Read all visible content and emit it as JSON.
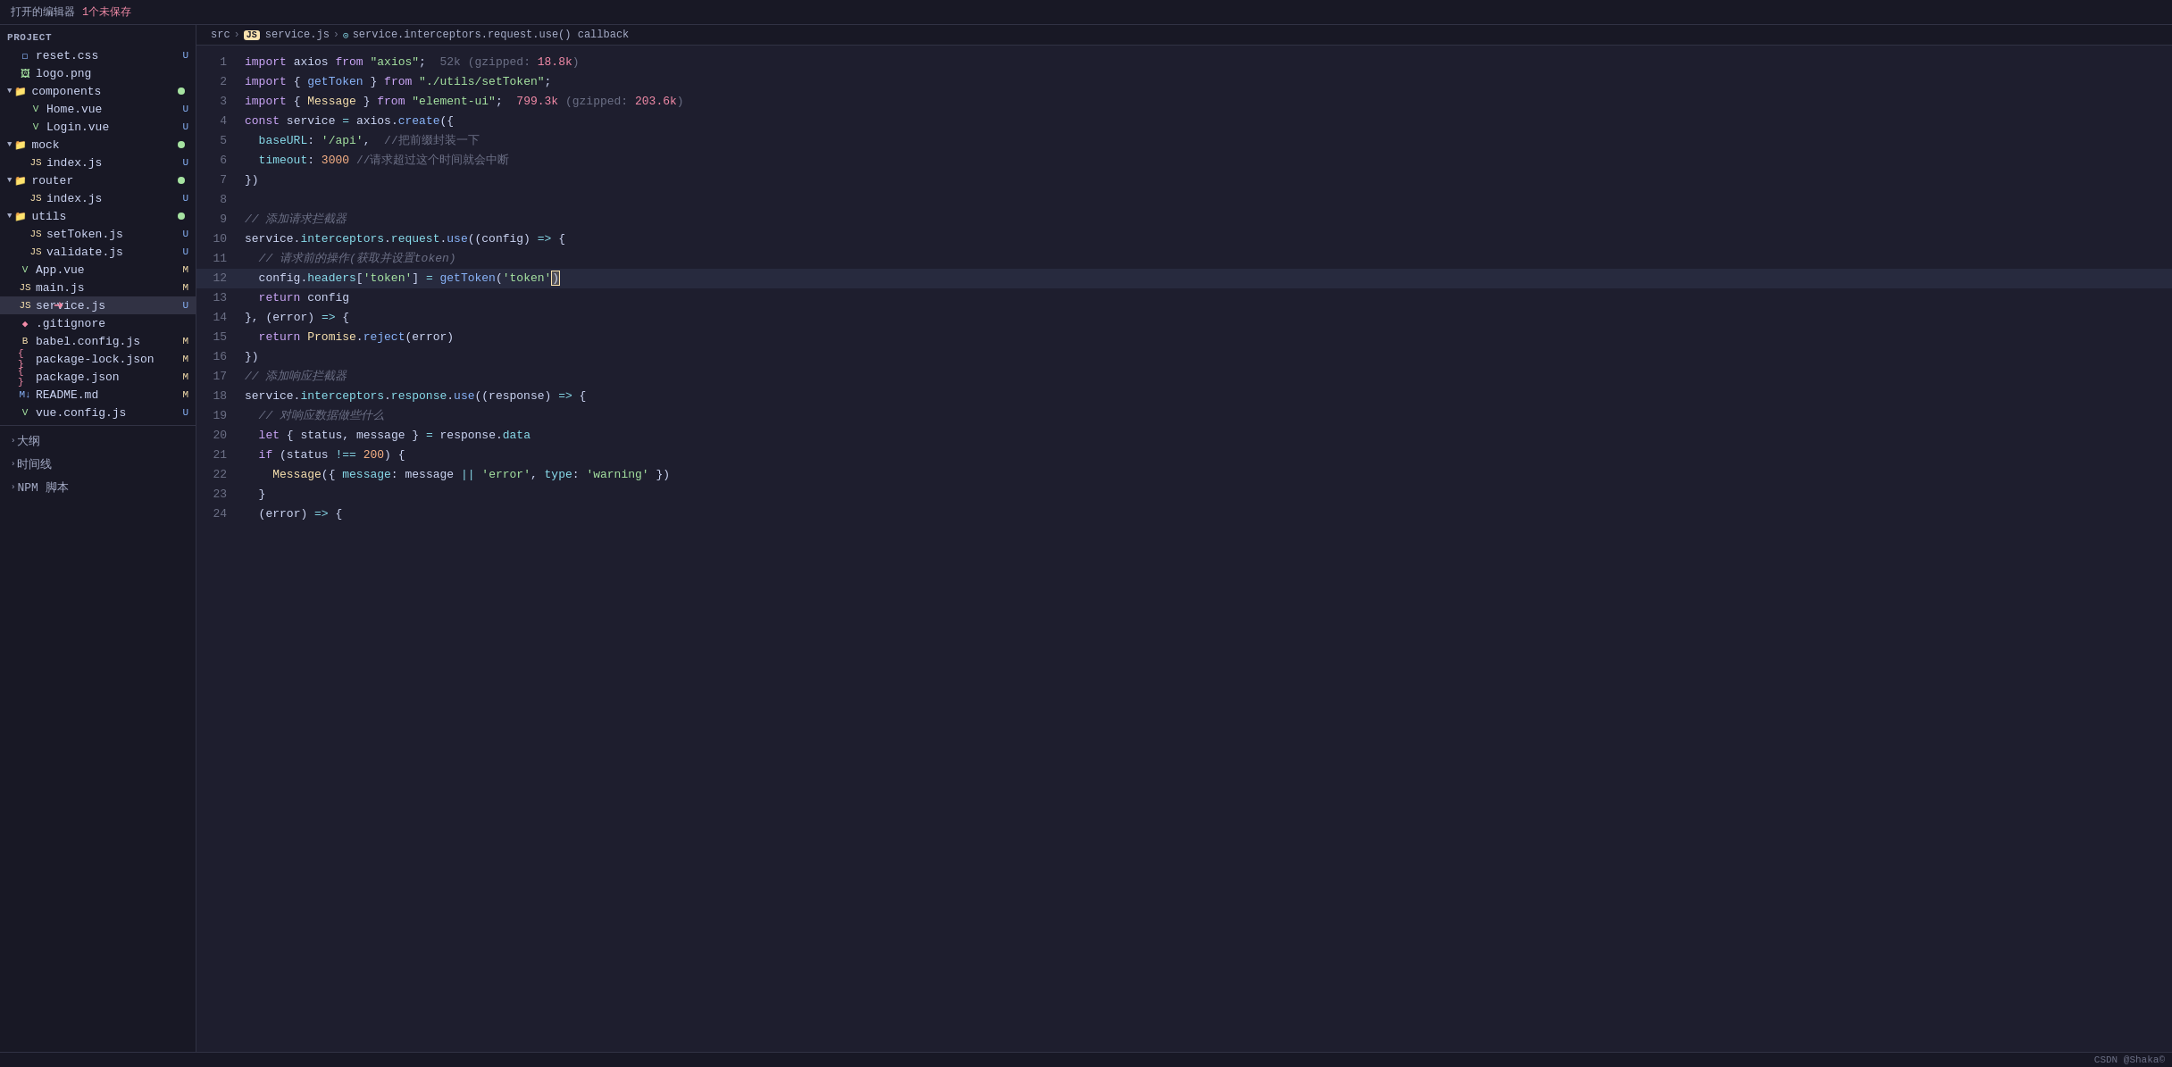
{
  "topbar": {
    "title": "打开的编辑器",
    "unsaved": "1个未保存"
  },
  "sidebar": {
    "project_label": "PROJECT",
    "items": [
      {
        "id": "reset-css",
        "label": "reset.css",
        "indent": 2,
        "icon": "css",
        "badge": "U"
      },
      {
        "id": "logo-png",
        "label": "logo.png",
        "indent": 2,
        "icon": "img",
        "badge": ""
      },
      {
        "id": "components",
        "label": "components",
        "indent": 1,
        "icon": "folder",
        "badge": "",
        "dot": true,
        "expanded": true
      },
      {
        "id": "home-vue",
        "label": "Home.vue",
        "indent": 3,
        "icon": "vue",
        "badge": "U"
      },
      {
        "id": "login-vue",
        "label": "Login.vue",
        "indent": 3,
        "icon": "vue",
        "badge": "U"
      },
      {
        "id": "mock",
        "label": "mock",
        "indent": 1,
        "icon": "folder",
        "badge": "",
        "dot": true,
        "expanded": true
      },
      {
        "id": "mock-index-js",
        "label": "index.js",
        "indent": 3,
        "icon": "js",
        "badge": "U"
      },
      {
        "id": "router",
        "label": "router",
        "indent": 1,
        "icon": "folder",
        "badge": "",
        "dot": true,
        "expanded": true
      },
      {
        "id": "router-index-js",
        "label": "index.js",
        "indent": 3,
        "icon": "js",
        "badge": "U"
      },
      {
        "id": "utils",
        "label": "utils",
        "indent": 1,
        "icon": "folder",
        "badge": "",
        "dot": true,
        "expanded": true
      },
      {
        "id": "settoken-js",
        "label": "setToken.js",
        "indent": 3,
        "icon": "js",
        "badge": "U"
      },
      {
        "id": "validate-js",
        "label": "validate.js",
        "indent": 3,
        "icon": "js",
        "badge": "U"
      },
      {
        "id": "app-vue",
        "label": "App.vue",
        "indent": 2,
        "icon": "vue",
        "badge": "M"
      },
      {
        "id": "main-js",
        "label": "main.js",
        "indent": 2,
        "icon": "js",
        "badge": "M"
      },
      {
        "id": "service-js",
        "label": "service.js",
        "indent": 2,
        "icon": "js",
        "badge": "U",
        "active": true
      },
      {
        "id": "gitignore",
        "label": ".gitignore",
        "indent": 2,
        "icon": "git",
        "badge": ""
      },
      {
        "id": "babel-config-js",
        "label": "babel.config.js",
        "indent": 2,
        "icon": "babel",
        "badge": "M"
      },
      {
        "id": "package-lock-json",
        "label": "package-lock.json",
        "indent": 2,
        "icon": "pkg",
        "badge": "M"
      },
      {
        "id": "package-json",
        "label": "package.json",
        "indent": 2,
        "icon": "pkg",
        "badge": "M"
      },
      {
        "id": "readme-md",
        "label": "README.md",
        "indent": 2,
        "icon": "md",
        "badge": "M"
      },
      {
        "id": "vue-config-js",
        "label": "vue.config.js",
        "indent": 2,
        "icon": "vueconfig",
        "badge": "U"
      }
    ],
    "bottom": [
      {
        "id": "outline",
        "label": "大纲"
      },
      {
        "id": "timeline",
        "label": "时间线"
      },
      {
        "id": "npm-scripts",
        "label": "NPM 脚本"
      }
    ]
  },
  "breadcrumb": {
    "parts": [
      "src",
      "JS service.js",
      "service.interceptors.request.use() callback"
    ]
  },
  "code_lines": [
    {
      "num": 1,
      "content": "import",
      "type": "mixed"
    },
    {
      "num": 2,
      "content": "import { getToken } from \"./utils/setToken\";",
      "type": "mixed"
    },
    {
      "num": 3,
      "content": "import { Message } from \"element-ui\";",
      "type": "mixed"
    },
    {
      "num": 4,
      "content": "const service = axios.create({",
      "type": "mixed"
    },
    {
      "num": 5,
      "content": "  baseURL: '/api',  //把前缀封装一下",
      "type": "mixed"
    },
    {
      "num": 6,
      "content": "  timeout: 3000 //请求超过这个时间就会中断",
      "type": "mixed"
    },
    {
      "num": 7,
      "content": "})",
      "type": "mixed"
    },
    {
      "num": 8,
      "content": "",
      "type": "empty"
    },
    {
      "num": 9,
      "content": "// 添加请求拦截器",
      "type": "comment"
    },
    {
      "num": 10,
      "content": "service.interceptors.request.use((config) => {",
      "type": "mixed"
    },
    {
      "num": 11,
      "content": "  // 请求前的操作(获取并设置token)",
      "type": "comment"
    },
    {
      "num": 12,
      "content": "  config.headers['token'] = getToken('token')",
      "type": "mixed",
      "highlighted": true
    },
    {
      "num": 13,
      "content": "  return config",
      "type": "mixed"
    },
    {
      "num": 14,
      "content": "}, (error) => {",
      "type": "mixed"
    },
    {
      "num": 15,
      "content": "  return Promise.reject(error)",
      "type": "mixed"
    },
    {
      "num": 16,
      "content": "})",
      "type": "mixed"
    },
    {
      "num": 17,
      "content": "// 添加响应拦截器",
      "type": "comment"
    },
    {
      "num": 18,
      "content": "service.interceptors.response.use((response) => {",
      "type": "mixed"
    },
    {
      "num": 19,
      "content": "  // 对响应数据做些什么",
      "type": "comment"
    },
    {
      "num": 20,
      "content": "  let { status, message } = response.data",
      "type": "mixed"
    },
    {
      "num": 21,
      "content": "  if (status !== 200) {",
      "type": "mixed"
    },
    {
      "num": 22,
      "content": "    Message({ message: message || 'error', type: 'warning' })",
      "type": "mixed"
    },
    {
      "num": 23,
      "content": "  }",
      "type": "mixed"
    },
    {
      "num": 24,
      "content": "  (error) => {",
      "type": "mixed"
    }
  ],
  "bottom_bar": {
    "credit": "CSDN @Shaka©"
  }
}
